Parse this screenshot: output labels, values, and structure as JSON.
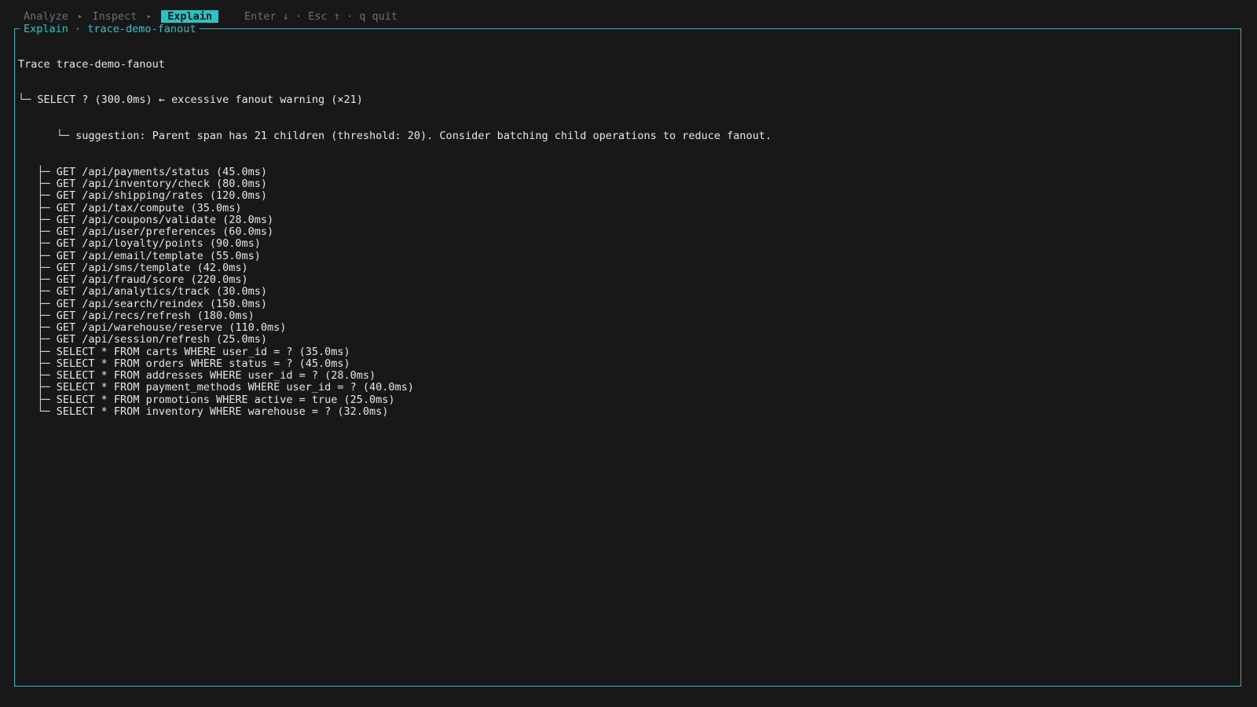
{
  "breadcrumbs": {
    "analyze": "Analyze",
    "inspect": "Inspect",
    "explain": "Explain",
    "separator": "▸"
  },
  "hint": "Enter ↓ · Esc ↑ · q quit",
  "panel": {
    "title": "Explain · trace-demo-fanout"
  },
  "trace": {
    "header": "Trace trace-demo-fanout",
    "root": "SELECT ? (300.0ms) ← excessive fanout warning (×21)",
    "suggestion": "suggestion: Parent span has 21 children (threshold: 20). Consider batching child operations to reduce fanout.",
    "children": [
      "GET /api/payments/status (45.0ms)",
      "GET /api/inventory/check (80.0ms)",
      "GET /api/shipping/rates (120.0ms)",
      "GET /api/tax/compute (35.0ms)",
      "GET /api/coupons/validate (28.0ms)",
      "GET /api/user/preferences (60.0ms)",
      "GET /api/loyalty/points (90.0ms)",
      "GET /api/email/template (55.0ms)",
      "GET /api/sms/template (42.0ms)",
      "GET /api/fraud/score (220.0ms)",
      "GET /api/analytics/track (30.0ms)",
      "GET /api/search/reindex (150.0ms)",
      "GET /api/recs/refresh (180.0ms)",
      "GET /api/warehouse/reserve (110.0ms)",
      "GET /api/session/refresh (25.0ms)",
      "SELECT * FROM carts WHERE user_id = ? (35.0ms)",
      "SELECT * FROM orders WHERE status = ? (45.0ms)",
      "SELECT * FROM addresses WHERE user_id = ? (28.0ms)",
      "SELECT * FROM payment_methods WHERE user_id = ? (40.0ms)",
      "SELECT * FROM promotions WHERE active = true (25.0ms)",
      "SELECT * FROM inventory WHERE warehouse = ? (32.0ms)"
    ]
  },
  "colors": {
    "background": "#181818",
    "accent": "#1fc7c7",
    "border": "#1fb5c2",
    "dim": "#6f6f6f",
    "text": "#e6e6e6"
  }
}
